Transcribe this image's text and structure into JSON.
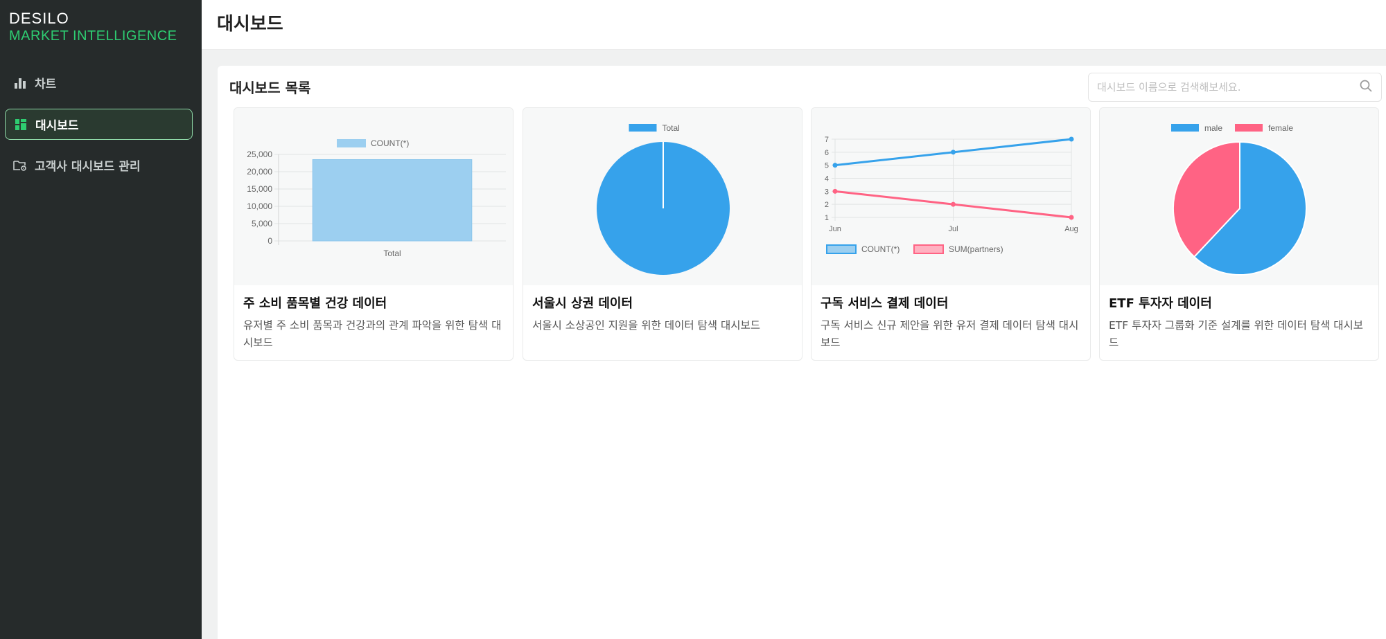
{
  "sidebar": {
    "brand_name": "DESILO",
    "brand_sub": "MARKET INTELLIGENCE",
    "items": [
      {
        "label": "차트",
        "icon": "bar-chart-icon"
      },
      {
        "label": "대시보드",
        "icon": "dashboard-grid-icon",
        "active": true
      },
      {
        "label": "고객사 대시보드 관리",
        "icon": "folder-settings-icon"
      }
    ]
  },
  "header": {
    "title": "대시보드"
  },
  "main": {
    "panel_title": "대시보드 목록",
    "search": {
      "placeholder": "대시보드 이름으로 검색해보세요.",
      "value": "",
      "icon": "search-icon"
    },
    "cards": [
      {
        "title": "주 소비 품목별 건강 데이터",
        "description": "유저별 주 소비 품목과 건강과의 관계 파악을 위한 탐색 대시보드"
      },
      {
        "title": "서울시 상권 데이터",
        "description": "서울시 소상공인 지원을 위한 데이터 탐색 대시보드"
      },
      {
        "title": "구독 서비스 결제 데이터",
        "description": "구독 서비스 신규 제안을 위한 유저 결제 데이터 탐색 대시보드"
      },
      {
        "title": "ETF 투자자 데이터",
        "description": "ETF 투자자 그룹화 기준 설계를 위한 데이터 탐색 대시보드"
      }
    ]
  },
  "colors": {
    "accent": "#2ecc71",
    "blue": "#36a2eb",
    "pink": "#ff6384",
    "sidebar_bg": "#262b2b"
  },
  "chart_data": [
    {
      "type": "bar",
      "categories": [
        "Total"
      ],
      "series": [
        {
          "name": "COUNT(*)",
          "values": [
            23500
          ]
        }
      ],
      "ylim": [
        0,
        25000
      ],
      "yticks": [
        "25,000",
        "20,000",
        "15,000",
        "10,000",
        "5,000",
        "0"
      ],
      "legend": "top"
    },
    {
      "type": "pie",
      "labels": [
        "Total"
      ],
      "values": [
        100
      ],
      "legend": "top"
    },
    {
      "type": "line",
      "categories": [
        "Jun",
        "Jul",
        "Aug"
      ],
      "series": [
        {
          "name": "COUNT(*)",
          "values": [
            5,
            6,
            7
          ]
        },
        {
          "name": "SUM(partners)",
          "values": [
            3,
            2,
            1
          ]
        }
      ],
      "ylim": [
        1,
        7
      ],
      "yticks": [
        "7",
        "6",
        "5",
        "4",
        "3",
        "2",
        "1"
      ],
      "legend": "bottom"
    },
    {
      "type": "pie",
      "labels": [
        "male",
        "female"
      ],
      "values": [
        62,
        38
      ],
      "legend": "top"
    }
  ]
}
